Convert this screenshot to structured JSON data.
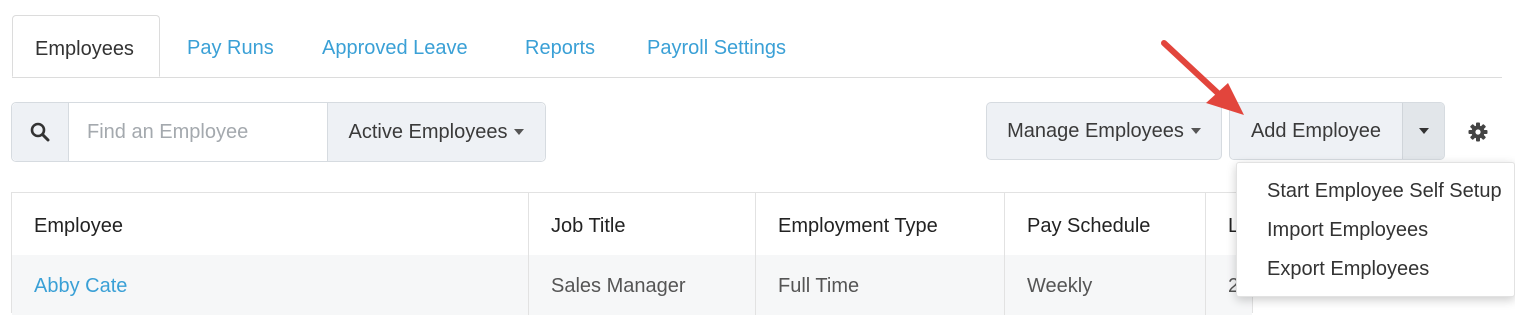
{
  "tabs": [
    {
      "label": "Employees",
      "active": true
    },
    {
      "label": "Pay Runs"
    },
    {
      "label": "Approved Leave"
    },
    {
      "label": "Reports"
    },
    {
      "label": "Payroll Settings"
    }
  ],
  "search": {
    "placeholder": "Find an Employee",
    "value": "",
    "icon": "search-icon"
  },
  "filter": {
    "label": "Active Employees"
  },
  "toolbar": {
    "manage_label": "Manage Employees",
    "add_label": "Add Employee",
    "settings_icon": "gear-icon"
  },
  "add_menu": {
    "items": [
      "Start Employee Self Setup",
      "Import Employees",
      "Export Employees"
    ]
  },
  "table": {
    "columns": [
      "Employee",
      "Job Title",
      "Employment Type",
      "Pay Schedule",
      "L"
    ],
    "rows": [
      {
        "employee": "Abby Cate",
        "job_title": "Sales Manager",
        "employment_type": "Full Time",
        "pay_schedule": "Weekly",
        "last": "2"
      }
    ]
  },
  "colors": {
    "link": "#3aa0d6",
    "annotation_arrow": "#e2453c",
    "button_bg": "#eef1f5"
  }
}
